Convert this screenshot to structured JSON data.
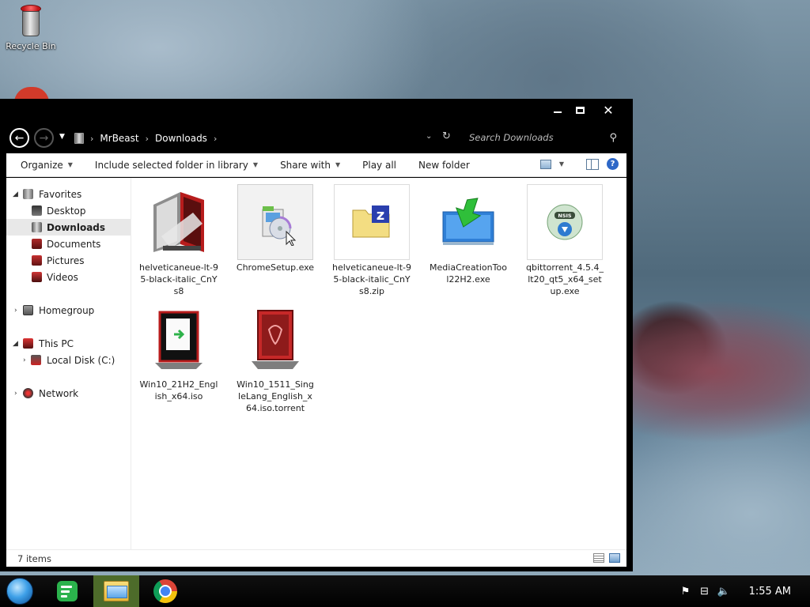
{
  "desktop": {
    "icons": [
      {
        "label": "Recycle Bin",
        "icon": "recycle-bin-icon"
      }
    ]
  },
  "window": {
    "controls": {
      "minimize": "minimize-icon",
      "maximize": "maximize-icon",
      "close": "✕"
    },
    "nav": {
      "back": "←",
      "forward": "→",
      "recent": "▼"
    },
    "breadcrumb": [
      "MrBeast",
      "Downloads"
    ],
    "search_placeholder": "Search Downloads",
    "toolbar": {
      "organize": "Organize",
      "include": "Include selected folder in library",
      "share": "Share with",
      "play_all": "Play all",
      "new_folder": "New folder"
    },
    "sidebar": {
      "items": [
        {
          "label": "Favorites",
          "icon": "favorites-icon"
        },
        {
          "label": "Desktop",
          "icon": "desktop-icon"
        },
        {
          "label": "Downloads",
          "icon": "downloads-icon"
        },
        {
          "label": "Documents",
          "icon": "documents-icon"
        },
        {
          "label": "Pictures",
          "icon": "pictures-icon"
        },
        {
          "label": "Videos",
          "icon": "videos-icon"
        },
        {
          "label": "Homegroup",
          "icon": "homegroup-icon"
        },
        {
          "label": "This PC",
          "icon": "this-pc-icon"
        },
        {
          "label": "Local Disk (C:)",
          "icon": "local-disk-icon"
        },
        {
          "label": "Network",
          "icon": "network-icon"
        }
      ]
    },
    "files": [
      {
        "name": "helveticaneue-lt-95-black-italic_CnYs8",
        "icon": "folder-icon"
      },
      {
        "name": "ChromeSetup.exe",
        "icon": "installer-icon"
      },
      {
        "name": "helveticaneue-lt-95-black-italic_CnYs8.zip",
        "icon": "zip-folder-icon"
      },
      {
        "name": "MediaCreationTool22H2.exe",
        "icon": "media-creation-tool-icon"
      },
      {
        "name": "qbittorrent_4.5.4_lt20_qt5_x64_setup.exe",
        "icon": "qbittorrent-setup-icon"
      },
      {
        "name": "Win10_21H2_English_x64.iso",
        "icon": "iso-file-icon"
      },
      {
        "name": "Win10_1511_SingleLang_English_x64.iso.torrent",
        "icon": "torrent-file-icon"
      }
    ],
    "status": "7 items"
  },
  "taskbar": {
    "apps": [
      {
        "name": "start-button"
      },
      {
        "name": "feedly-app"
      },
      {
        "name": "file-explorer-app",
        "active": true
      },
      {
        "name": "chrome-app"
      }
    ],
    "clock": "1:55 AM"
  },
  "colors": {
    "window_chrome": "#000000",
    "content_bg": "#ffffff",
    "selected_item": "#e8e8e8",
    "taskbar_active": "#4d6b2a"
  }
}
